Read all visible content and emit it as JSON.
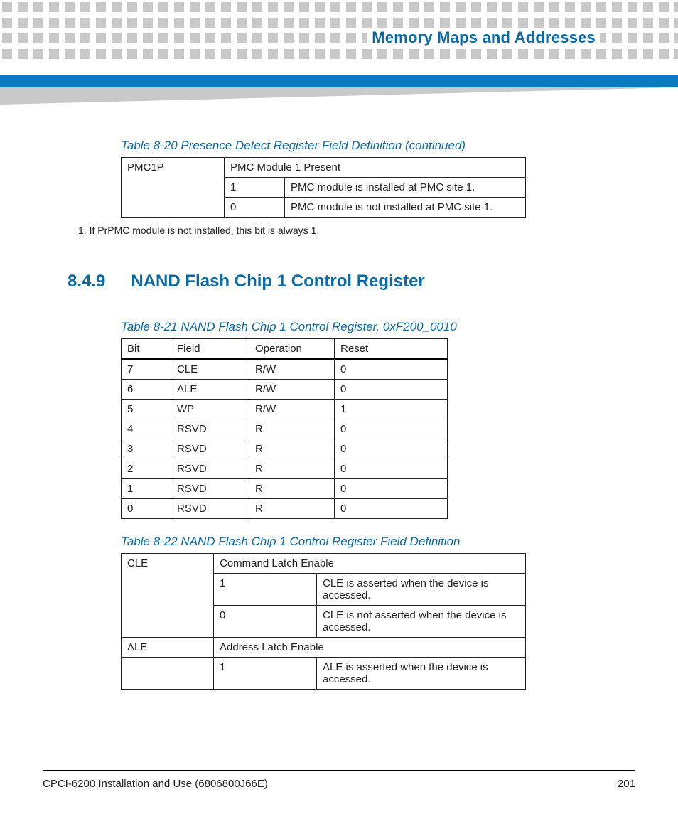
{
  "header": {
    "chapter_title": "Memory Maps and Addresses"
  },
  "table_8_20": {
    "caption": "Table 8-20 Presence Detect Register Field Definition (continued)",
    "field_name": "PMC1P",
    "field_desc": "PMC Module 1 Present",
    "val1": "1",
    "val1_desc": "PMC module is installed at PMC site 1.",
    "val0": "0",
    "val0_desc": "PMC module is not installed at PMC site 1.",
    "footnote": "1. If PrPMC module is not installed, this bit is always 1."
  },
  "section": {
    "number": "8.4.9",
    "title": "NAND Flash Chip 1 Control Register"
  },
  "table_8_21": {
    "caption": "Table 8-21 NAND Flash Chip 1 Control Register, 0xF200_0010",
    "h_bit": "Bit",
    "h_field": "Field",
    "h_op": "Operation",
    "h_reset": "Reset",
    "rows": [
      {
        "bit": "7",
        "field": "CLE",
        "op": "R/W",
        "reset": "0"
      },
      {
        "bit": "6",
        "field": "ALE",
        "op": "R/W",
        "reset": "0"
      },
      {
        "bit": "5",
        "field": "WP",
        "op": "R/W",
        "reset": "1"
      },
      {
        "bit": "4",
        "field": "RSVD",
        "op": "R",
        "reset": "0"
      },
      {
        "bit": "3",
        "field": "RSVD",
        "op": "R",
        "reset": "0"
      },
      {
        "bit": "2",
        "field": "RSVD",
        "op": "R",
        "reset": "0"
      },
      {
        "bit": "1",
        "field": "RSVD",
        "op": "R",
        "reset": "0"
      },
      {
        "bit": "0",
        "field": "RSVD",
        "op": "R",
        "reset": "0"
      }
    ]
  },
  "table_8_22": {
    "caption": "Table 8-22 NAND Flash Chip 1 Control Register Field Definition",
    "cle_name": "CLE",
    "cle_desc": "Command Latch Enable",
    "cle_1": "1",
    "cle_1_desc": "CLE is asserted when the device is accessed.",
    "cle_0": "0",
    "cle_0_desc": "CLE is not asserted when the device is accessed.",
    "ale_name": "ALE",
    "ale_desc": "Address Latch Enable",
    "ale_1": "1",
    "ale_1_desc": "ALE is asserted when the device is accessed."
  },
  "footer": {
    "doc": "CPCI-6200 Installation and Use (6806800J66E)",
    "page": "201"
  }
}
